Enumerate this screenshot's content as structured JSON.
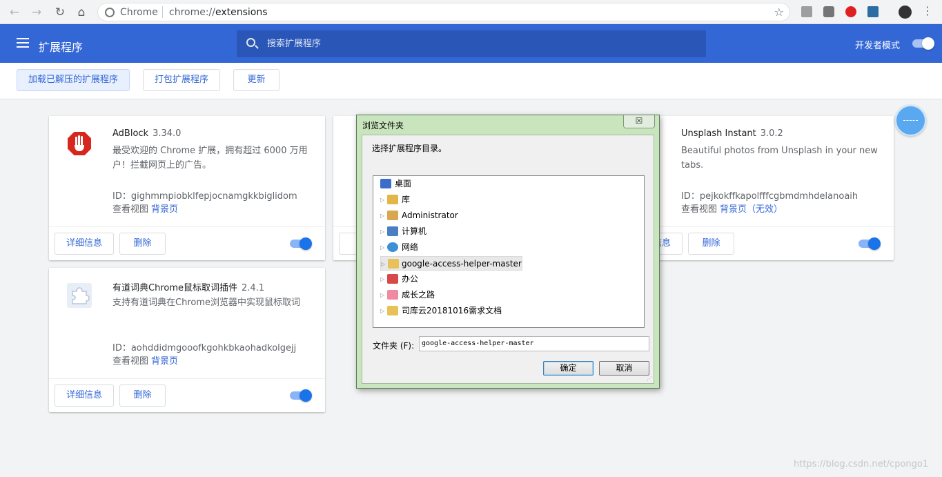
{
  "browser": {
    "site_label": "Chrome",
    "url_scheme": "chrome://",
    "url_host": "extensions"
  },
  "header": {
    "title": "扩展程序",
    "search_placeholder": "搜索扩展程序",
    "dev_mode_label": "开发者模式",
    "dev_mode_on": true
  },
  "toolbar": {
    "load_unpacked": "加载已解压的扩展程序",
    "pack": "打包扩展程序",
    "update": "更新"
  },
  "extensions": [
    {
      "name": "AdBlock",
      "version": "3.34.0",
      "description": "最受欢迎的 Chrome 扩展，拥有超过 6000 万用户！拦截网页上的广告。",
      "id": "ID：gighmmpiobklfepjocnamgkkbiglidom",
      "views_label": "查看视图",
      "view_link": "背景页",
      "view_suffix": "",
      "details": "详细信息",
      "remove": "删除",
      "enabled": true
    },
    {
      "name": "Unsplash Instant",
      "version": "3.0.2",
      "description": "Beautiful photos from Unsplash in your new tabs.",
      "id": "ID：pejkokffkapolfffcgbmdmhdelanoaih",
      "views_label": "查看视图",
      "view_link": "背景页",
      "view_suffix": "（无效）",
      "details": "详细信息",
      "remove": "删除",
      "enabled": true
    },
    {
      "name": "有道词典Chrome鼠标取词插件",
      "version": "2.4.1",
      "description": "支持有道词典在Chrome浏览器中实现鼠标取词",
      "id": "ID：aohddidmgooofkgohkbkaohadkolgejj",
      "views_label": "查看视图",
      "view_link": "背景页",
      "view_suffix": "",
      "details": "详细信息",
      "remove": "删除",
      "enabled": true
    }
  ],
  "dialog": {
    "title": "浏览文件夹",
    "close": "☒",
    "prompt": "选择扩展程序目录。",
    "tree": [
      "桌面",
      "库",
      "Administrator",
      "计算机",
      "网络",
      "google-access-helper-master",
      "办公",
      "成长之路",
      "司库云20181016需求文档"
    ],
    "selected": "google-access-helper-master",
    "folder_label": "文件夹 (F):",
    "folder_value": "google-access-helper-master",
    "ok": "确定",
    "cancel": "取消"
  },
  "watermark": "https://blog.csdn.net/cpongo1"
}
